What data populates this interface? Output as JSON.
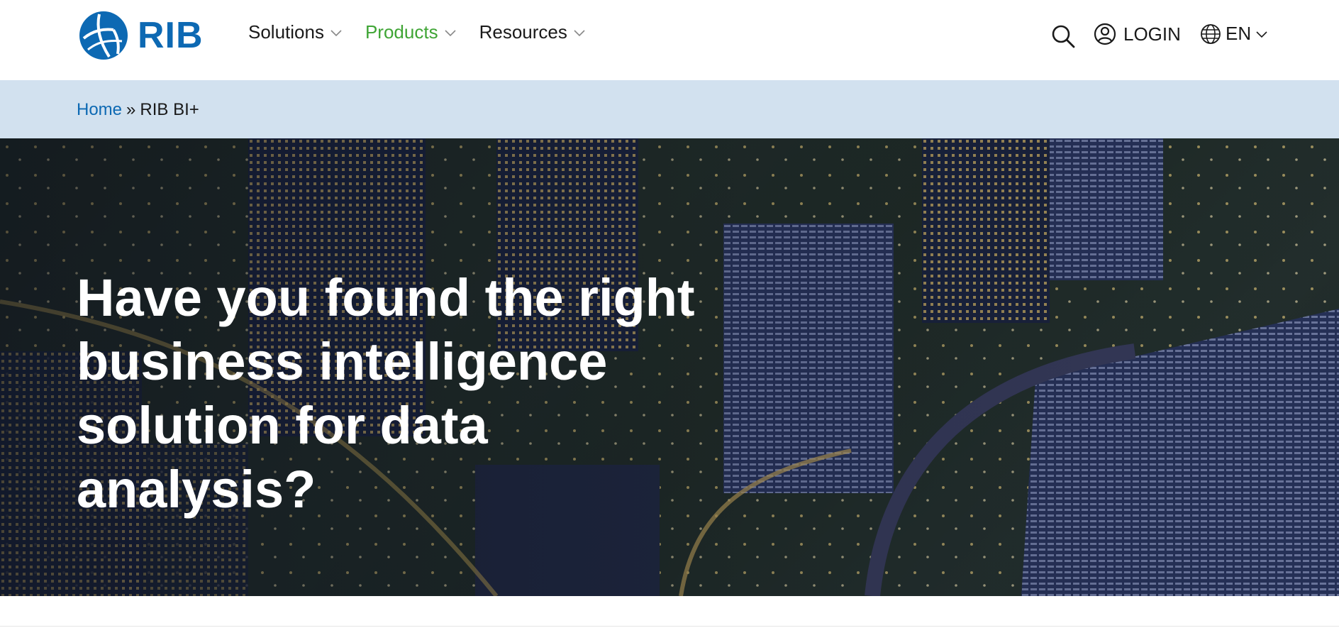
{
  "header": {
    "logo_text": "RIB",
    "nav": [
      {
        "label": "Solutions",
        "active": false
      },
      {
        "label": "Products",
        "active": true
      },
      {
        "label": "Resources",
        "active": false
      }
    ],
    "login_label": "LOGIN",
    "language": "EN",
    "icons": [
      "rib-logo-icon",
      "search-icon",
      "user-icon",
      "globe-icon",
      "chevron-down-icon"
    ]
  },
  "breadcrumb": {
    "home": "Home",
    "separator": "»",
    "current": "RIB BI+"
  },
  "hero": {
    "title": "Have you found the right\nbusiness intelligence\nsolution for data analysis?"
  },
  "colors": {
    "brand_blue": "#0d69b3",
    "active_green": "#3fa535",
    "breadcrumb_bg": "#d2e1ef"
  }
}
